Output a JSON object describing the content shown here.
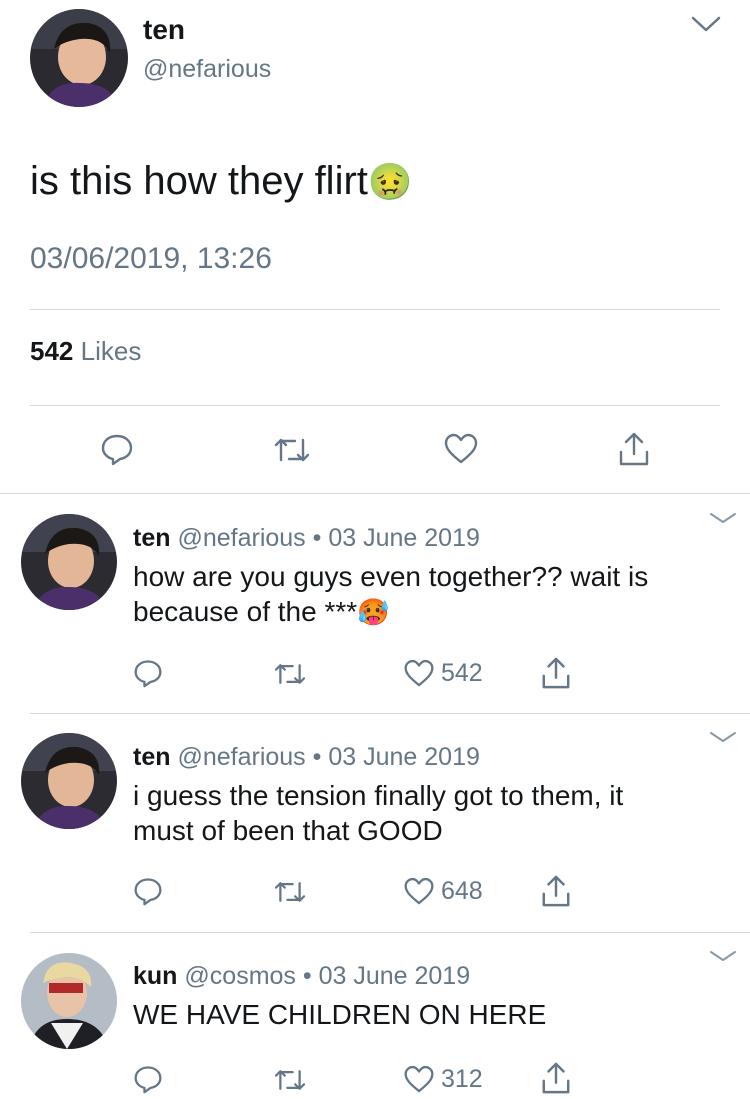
{
  "main_tweet": {
    "name": "ten",
    "handle": "@nefarious",
    "text": "is this how they flirt",
    "emoji": "🤢",
    "timestamp": "03/06/2019, 13:26",
    "likes_count": "542",
    "likes_label": "Likes"
  },
  "replies": [
    {
      "name": "ten",
      "handle": "@nefarious",
      "date": "03 June 2019",
      "text_line1": "how are you guys even together?? wait is",
      "text_line2": "because of the ***",
      "emoji": "🥵",
      "like_count": "542"
    },
    {
      "name": "ten",
      "handle": "@nefarious",
      "date": "03 June 2019",
      "text_line1": "i guess the tension finally got to them, it",
      "text_line2": "must of been that GOOD",
      "like_count": "648"
    },
    {
      "name": "kun",
      "handle": "@cosmos",
      "date": "03 June 2019",
      "text_line1": "WE HAVE CHILDREN ON HERE",
      "like_count": "312"
    }
  ],
  "separator": "•",
  "icons": {
    "reply": "reply-icon",
    "retweet": "retweet-icon",
    "like": "heart-icon",
    "share": "share-icon",
    "more": "chevron-down-icon"
  },
  "colors": {
    "muted": "#657786",
    "divider": "#d6d9db",
    "text": "#14171a"
  }
}
